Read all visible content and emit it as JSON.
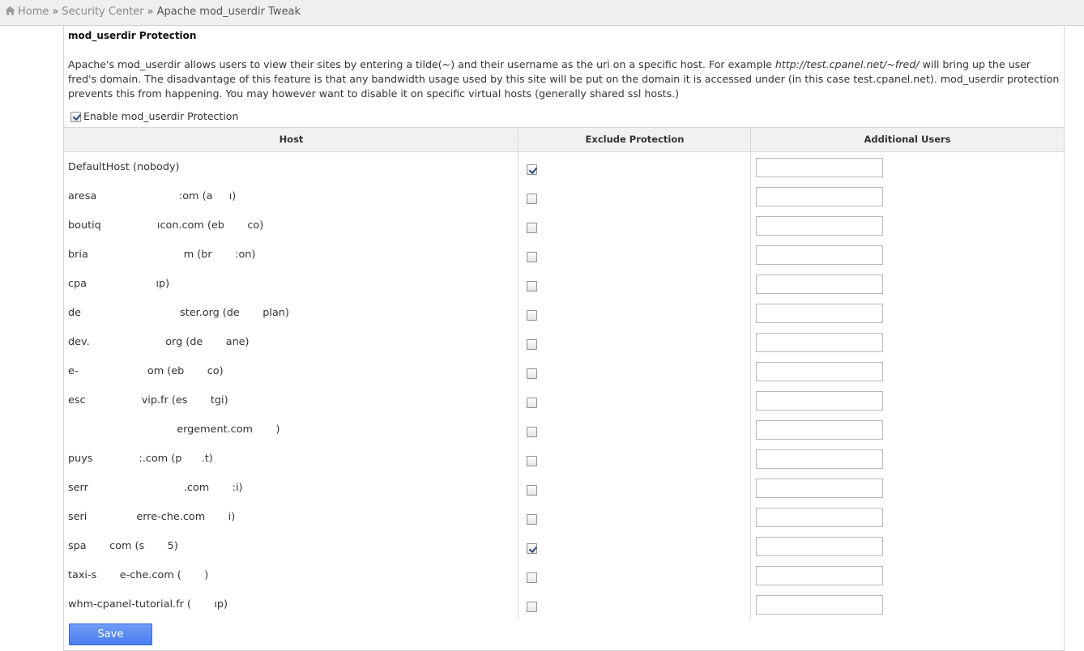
{
  "breadcrumb": {
    "home_icon": "home-icon",
    "home": "Home",
    "separator": "»",
    "security_center": "Security Center",
    "current": "Apache mod_userdir Tweak"
  },
  "panel": {
    "title": "mod_userdir Protection",
    "description": {
      "part1": "Apache's mod_userdir allows users to view their sites by entering a tilde(~) and their username as the uri on a specific host. For example ",
      "example_url": "http://test.cpanel.net/~fred/",
      "part2": " will bring up the user fred's domain. The disadvantage of this feature is that any bandwidth usage used by this site will be put on the domain it is accessed under (in this case test.cpanel.net). mod_userdir protection prevents this from happening. You may however want to disable it on specific virtual hosts (generally shared ssl hosts.)"
    },
    "enable_label": "Enable mod_userdir Protection",
    "enable_checked": true
  },
  "table": {
    "headers": {
      "host": "Host",
      "exclude": "Exclude Protection",
      "users": "Additional Users"
    },
    "rows": [
      {
        "host": "DefaultHost (nobody)",
        "excluded": true,
        "users": ""
      },
      {
        "host": "aresa                         :om (a     ı)",
        "excluded": false,
        "users": ""
      },
      {
        "host": "boutiq                 ıcon.com (eb       co)",
        "excluded": false,
        "users": ""
      },
      {
        "host": "bria                             m (br       :on)",
        "excluded": false,
        "users": ""
      },
      {
        "host": "cpa                     ıp)",
        "excluded": false,
        "users": ""
      },
      {
        "host": "de                              ster.org (de       plan)",
        "excluded": false,
        "users": ""
      },
      {
        "host": "dev.                       org (de       ane)",
        "excluded": false,
        "users": ""
      },
      {
        "host": "e-                     om (eb       co)",
        "excluded": false,
        "users": ""
      },
      {
        "host": "esc                 vip.fr (es       tgi)",
        "excluded": false,
        "users": ""
      },
      {
        "host": "                                 ergement.com       )",
        "excluded": false,
        "users": ""
      },
      {
        "host": "puys              :.com (p      .t)",
        "excluded": false,
        "users": ""
      },
      {
        "host": "serr                             .com       :i)",
        "excluded": false,
        "users": ""
      },
      {
        "host": "seri               erre-che.com       i)",
        "excluded": false,
        "users": ""
      },
      {
        "host": "spa       com (s       5)",
        "excluded": true,
        "users": ""
      },
      {
        "host": "taxi-s       e-che.com (       )",
        "excluded": false,
        "users": ""
      },
      {
        "host": "whm-cpanel-tutorial.fr (       ıp)",
        "excluded": false,
        "users": ""
      }
    ]
  },
  "actions": {
    "save_label": "Save"
  },
  "colors": {
    "breadcrumb_bg": "#efefef",
    "header_bg": "#f1f1f1",
    "save_button": "#4a7ef0"
  }
}
